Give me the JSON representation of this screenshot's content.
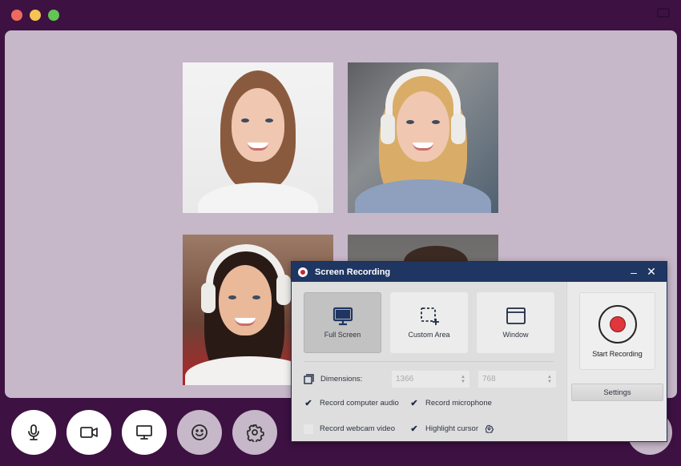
{
  "window": {
    "traffic_lights": [
      "close",
      "minimize",
      "maximize"
    ],
    "colors": {
      "background": "#3d1142",
      "stage": "#c6b7c9",
      "close": "#ee6a5f",
      "minimize": "#f5c451",
      "maximize": "#62c554"
    }
  },
  "participants": [
    {
      "name": "participant-1",
      "description": "woman with earphones, brown hair"
    },
    {
      "name": "participant-2",
      "description": "blonde woman with white headphones"
    },
    {
      "name": "participant-3",
      "description": "woman with white headphones, dark hair"
    },
    {
      "name": "participant-4",
      "description": "participant partly hidden by dialog"
    }
  ],
  "call_controls": [
    {
      "name": "microphone",
      "icon": "microphone-icon"
    },
    {
      "name": "camera",
      "icon": "video-camera-icon"
    },
    {
      "name": "share-screen",
      "icon": "monitor-icon"
    },
    {
      "name": "reactions",
      "icon": "smiley-icon"
    },
    {
      "name": "settings",
      "icon": "gear-icon"
    }
  ],
  "dialog": {
    "title": "Screen Recording",
    "title_icon": "record-icon",
    "minimize_label": "–",
    "close_label": "✕",
    "accent": "#1f3662",
    "modes": [
      {
        "label": "Full Screen",
        "icon": "monitor-icon",
        "active": true
      },
      {
        "label": "Custom Area",
        "icon": "custom-area-icon",
        "active": false
      },
      {
        "label": "Window",
        "icon": "window-icon",
        "active": false
      }
    ],
    "dimensions": {
      "label": "Dimensions:",
      "width": "1366",
      "height": "768",
      "up_arrow": "▲",
      "down_arrow": "▼"
    },
    "options": [
      {
        "label": "Record computer audio",
        "checked": true,
        "check_glyph": "✔"
      },
      {
        "label": "Record microphone",
        "checked": true,
        "check_glyph": "✔"
      },
      {
        "label": "Record webcam video",
        "checked": false,
        "check_glyph": ""
      },
      {
        "label": "Highlight cursor",
        "checked": true,
        "check_glyph": "✔"
      }
    ],
    "start_recording_label": "Start Recording",
    "record_color": "#e1363b",
    "settings_label": "Settings"
  }
}
